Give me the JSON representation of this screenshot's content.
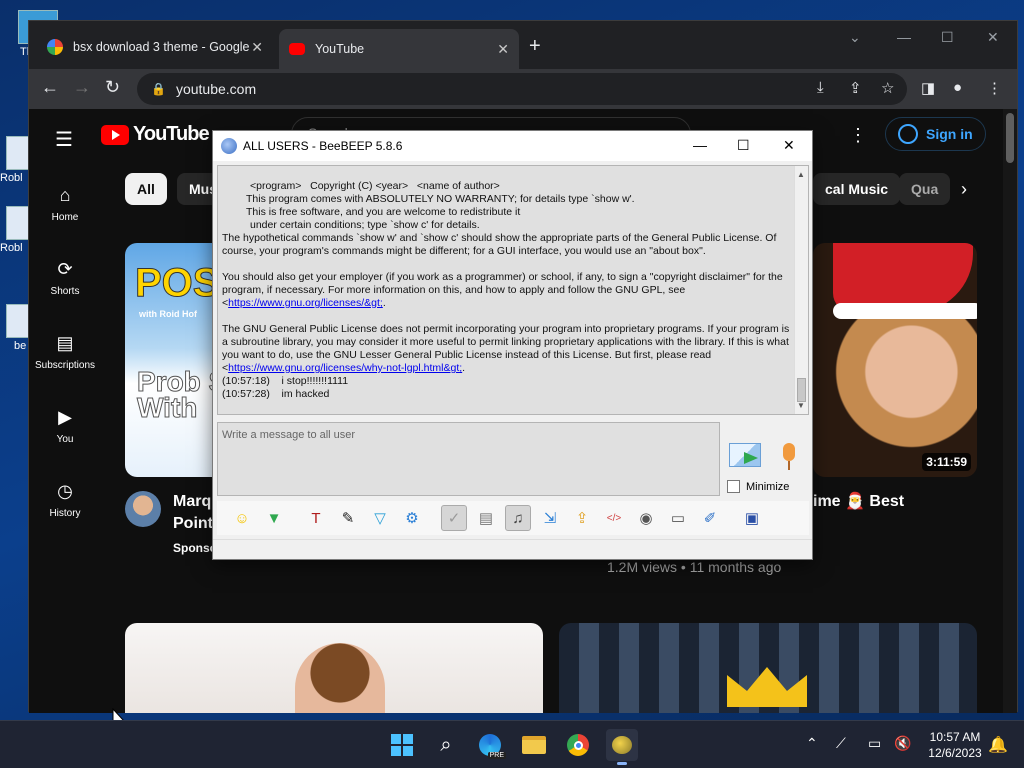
{
  "desktop": {
    "icons": [
      {
        "label": "Th"
      },
      {
        "label": "Robl"
      },
      {
        "label": "Robl"
      },
      {
        "label": "be"
      }
    ]
  },
  "browser": {
    "tabs": [
      {
        "title": "bsx download 3 theme - Google",
        "active": false
      },
      {
        "title": "YouTube",
        "active": true
      }
    ],
    "new_tab": "+",
    "url": "youtube.com",
    "window_controls": {
      "minimize": "—",
      "maximize": "☐",
      "close": "✕",
      "dropdown": "⌄"
    }
  },
  "youtube": {
    "logo_text": "YouTube",
    "search_placeholder": "Search",
    "sign_in": "Sign in",
    "sidebar": [
      {
        "label": "Home",
        "icon": "home-icon"
      },
      {
        "label": "Shorts",
        "icon": "shorts-icon"
      },
      {
        "label": "Subscriptions",
        "icon": "subscriptions-icon"
      },
      {
        "label": "You",
        "icon": "you-icon"
      },
      {
        "label": "History",
        "icon": "history-icon"
      }
    ],
    "chips": {
      "all": "All",
      "mus": "Mus",
      "classical": "cal Music",
      "qua": "Qua"
    },
    "video1": {
      "thumb_title": "POS",
      "thumb_sub": "with Roid Hof",
      "thumb_body": "Prob Solv With",
      "title_line1": "Marq",
      "title_line2": "Points",
      "sponsor": "Sponso"
    },
    "video2": {
      "duration": "3:11:59",
      "title": "ime 🎅 Best",
      "meta": "1.2M views • 11 months ago"
    }
  },
  "beebeep": {
    "title": "ALL USERS - BeeBEEP 5.8.6",
    "chat": {
      "license_indented": [
        "<program>   Copyright (C) <year>   <name of author>",
        "This program comes with ABSOLUTELY NO WARRANTY; for details type `show w'.",
        "This is free software, and you are welcome to redistribute it",
        "under certain conditions; type `show c' for details."
      ],
      "para1": "The hypothetical commands `show w' and `show c' should show the appropriate parts of the General Public License. Of course, your program's commands might be different; for a GUI interface, you would use an \"about box\".",
      "para2_text": "You should also get your employer (if you work as a programmer) or school, if any, to sign a \"copyright disclaimer\" for the program, if necessary. For more information on this, and how to apply and follow the GNU GPL, see <",
      "para2_link": "https://www.gnu.org/licenses/&gt;",
      "para2_end": ".",
      "para3_text": "The GNU General Public License does not permit incorporating your program into proprietary programs. If your program is a subroutine library, you may consider it more useful to permit linking proprietary applications with the library. If this is what you want to do, use the GNU Lesser General Public License instead of this License. But first, please read <",
      "para3_link": "https://www.gnu.org/licenses/why-not-lgpl.html&gt;",
      "para3_end": ".",
      "messages": [
        {
          "time": "(10:57:18)",
          "text": "i stop!!!!!!!1111"
        },
        {
          "time": "(10:57:28)",
          "text": "im hacked"
        }
      ]
    },
    "input_placeholder": "Write a message to all user",
    "minimize_label": "Minimize",
    "tools": [
      {
        "name": "emoticon-icon",
        "glyph": "☺",
        "color": "#f5c400"
      },
      {
        "name": "download-icon",
        "glyph": "▼",
        "color": "#2fa84f"
      },
      {
        "name": "font-icon",
        "glyph": "T",
        "color": "#b01c1c"
      },
      {
        "name": "color-icon",
        "glyph": "✎",
        "color": "#222222"
      },
      {
        "name": "filter-icon",
        "glyph": "▽",
        "color": "#2a9fd6"
      },
      {
        "name": "settings-icon",
        "glyph": "⚙",
        "color": "#2a7fd6"
      },
      {
        "name": "spellcheck-icon",
        "glyph": "✓",
        "color": "#999999"
      },
      {
        "name": "completer-icon",
        "glyph": "▤",
        "color": "#777777"
      },
      {
        "name": "music-icon",
        "glyph": "♫",
        "color": "#444444"
      },
      {
        "name": "send-file-icon",
        "glyph": "⇲",
        "color": "#2a7fd6"
      },
      {
        "name": "folder-share-icon",
        "glyph": "⇪",
        "color": "#e0a020"
      },
      {
        "name": "code-icon",
        "glyph": "</>",
        "color": "#d04040"
      },
      {
        "name": "screenshot-icon",
        "glyph": "◉",
        "color": "#555555"
      },
      {
        "name": "clear-icon",
        "glyph": "▭",
        "color": "#555555"
      },
      {
        "name": "edit-icon",
        "glyph": "✐",
        "color": "#2a6fc6"
      },
      {
        "name": "save-icon",
        "glyph": "▣",
        "color": "#2a4fa6"
      }
    ]
  },
  "taskbar": {
    "time": "10:57 AM",
    "date": "12/6/2023",
    "pre_badge": "PRE"
  }
}
